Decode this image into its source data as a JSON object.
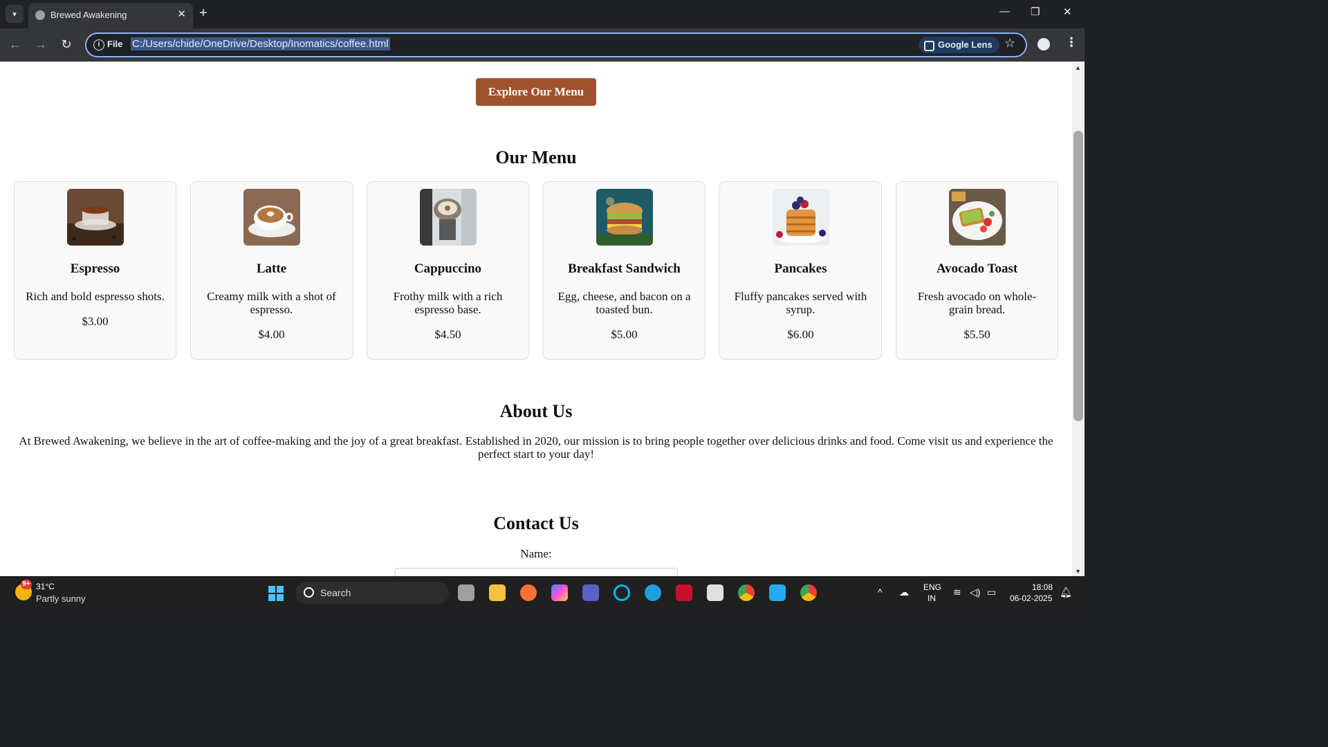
{
  "browser": {
    "tab_title": "Brewed Awakening",
    "new_tab": "+",
    "close_tab": "✕",
    "file_label": "File",
    "url": "C:/Users/chide/OneDrive/Desktop/Inomatics/coffee.html",
    "lens_label": "Google Lens"
  },
  "page": {
    "explore_button": "Explore Our Menu",
    "menu_title": "Our Menu",
    "menu_items": [
      {
        "name": "Espresso",
        "description": "Rich and bold espresso shots.",
        "price": "$3.00"
      },
      {
        "name": "Latte",
        "description": "Creamy milk with a shot of espresso.",
        "price": "$4.00"
      },
      {
        "name": "Cappuccino",
        "description": "Frothy milk with a rich espresso base.",
        "price": "$4.50"
      },
      {
        "name": "Breakfast Sandwich",
        "description": "Egg, cheese, and bacon on a toasted bun.",
        "price": "$5.00"
      },
      {
        "name": "Pancakes",
        "description": "Fluffy pancakes served with syrup.",
        "price": "$6.00"
      },
      {
        "name": "Avocado Toast",
        "description": "Fresh avocado on whole-grain bread.",
        "price": "$5.50"
      }
    ],
    "about_title": "About Us",
    "about_text": "At Brewed Awakening, we believe in the art of coffee-making and the joy of a great breakfast. Established in 2020, our mission is to bring people together over delicious drinks and food. Come visit us and experience the perfect start to your day!",
    "contact_title": "Contact Us",
    "name_label": "Name:"
  },
  "taskbar": {
    "weather_temp": "31°C",
    "weather_desc": "Partly sunny",
    "weather_badge": "9+",
    "search_label": "Search",
    "language": "ENG",
    "region": "IN",
    "time": "18:08",
    "date": "06-02-2025"
  }
}
